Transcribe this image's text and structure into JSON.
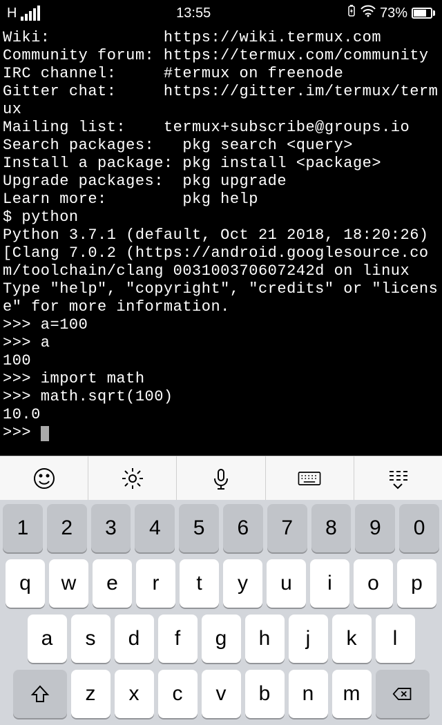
{
  "status": {
    "network": "H",
    "time": "13:55",
    "battery_pct": "73%"
  },
  "terminal": {
    "lines": [
      "Wiki:            https://wiki.termux.com",
      "Community forum: https://termux.com/community",
      "IRC channel:     #termux on freenode",
      "Gitter chat:     https://gitter.im/termux/termux",
      "Mailing list:    termux+subscribe@groups.io",
      "",
      "Search packages:   pkg search <query>",
      "Install a package: pkg install <package>",
      "Upgrade packages:  pkg upgrade",
      "Learn more:        pkg help",
      "$ python",
      "Python 3.7.1 (default, Oct 21 2018, 18:20:26)",
      "[Clang 7.0.2 (https://android.googlesource.com/toolchain/clang 003100370607242d on linux",
      "Type \"help\", \"copyright\", \"credits\" or \"license\" for more information.",
      ">>> a=100",
      ">>> a",
      "100",
      ">>> import math",
      ">>> math.sqrt(100)",
      "10.0",
      ">>> "
    ]
  },
  "toolbar": {
    "items": [
      "emoji",
      "settings",
      "mic",
      "keyboard",
      "collapse"
    ]
  },
  "keyboard": {
    "row_num": [
      "1",
      "2",
      "3",
      "4",
      "5",
      "6",
      "7",
      "8",
      "9",
      "0"
    ],
    "row_qwerty": [
      "q",
      "w",
      "e",
      "r",
      "t",
      "y",
      "u",
      "i",
      "o",
      "p"
    ],
    "row_asdf": [
      "a",
      "s",
      "d",
      "f",
      "g",
      "h",
      "j",
      "k",
      "l"
    ],
    "row_zxcv": [
      "z",
      "x",
      "c",
      "v",
      "b",
      "n",
      "m"
    ]
  }
}
